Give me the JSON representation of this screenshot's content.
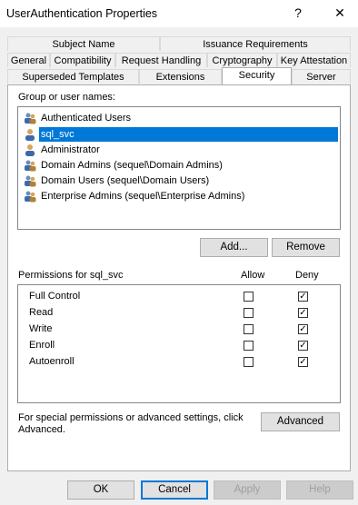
{
  "window": {
    "title": "UserAuthentication Properties",
    "help_glyph": "?",
    "close_glyph": "✕"
  },
  "tabs": {
    "row1": [
      "Subject Name",
      "Issuance Requirements"
    ],
    "row2": [
      "General",
      "Compatibility",
      "Request Handling",
      "Cryptography",
      "Key Attestation"
    ],
    "row3": [
      "Superseded Templates",
      "Extensions",
      "Security",
      "Server"
    ],
    "active": "Security"
  },
  "security": {
    "group_label": "Group or user names:",
    "users": [
      {
        "name": "Authenticated Users",
        "icon": "group-icon"
      },
      {
        "name": "sql_svc",
        "icon": "user-icon",
        "selected": true
      },
      {
        "name": "Administrator",
        "icon": "user-icon"
      },
      {
        "name": "Domain Admins (sequel\\Domain Admins)",
        "icon": "group-icon"
      },
      {
        "name": "Domain Users (sequel\\Domain Users)",
        "icon": "group-icon"
      },
      {
        "name": "Enterprise Admins (sequel\\Enterprise Admins)",
        "icon": "group-icon"
      }
    ],
    "add_label": "Add...",
    "remove_label": "Remove",
    "permissions_label": "Permissions for sql_svc",
    "allow_label": "Allow",
    "deny_label": "Deny",
    "permissions": [
      {
        "name": "Full Control",
        "allow": false,
        "deny": true
      },
      {
        "name": "Read",
        "allow": false,
        "deny": true
      },
      {
        "name": "Write",
        "allow": false,
        "deny": true
      },
      {
        "name": "Enroll",
        "allow": false,
        "deny": true
      },
      {
        "name": "Autoenroll",
        "allow": false,
        "deny": true
      }
    ],
    "special_text_1": "For special permissions or advanced settings, click",
    "special_text_2": "Advanced.",
    "advanced_label": "Advanced"
  },
  "footer": {
    "ok": "OK",
    "cancel": "Cancel",
    "apply": "Apply",
    "help": "Help"
  },
  "colors": {
    "selection": "#0078d7",
    "dialog_bg": "#f0f0f0"
  }
}
